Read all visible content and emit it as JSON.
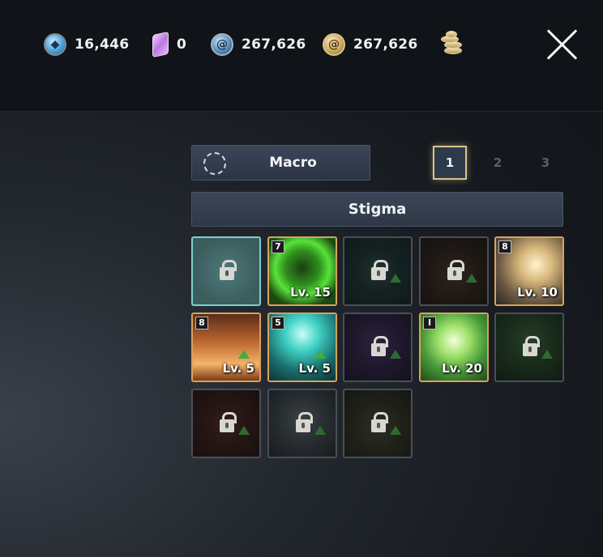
{
  "currencies": [
    {
      "name": "blue-gem",
      "value": "16,446"
    },
    {
      "name": "crystal",
      "value": "0"
    },
    {
      "name": "blue-coin",
      "value": "267,626"
    },
    {
      "name": "gold-coin",
      "value": "267,626"
    }
  ],
  "macro": {
    "label": "Macro"
  },
  "pages": [
    "1",
    "2",
    "3"
  ],
  "active_page": "1",
  "section_title": "Stigma",
  "slots": [
    {
      "state": "selected-empty",
      "tier": "",
      "level": ""
    },
    {
      "state": "unlocked",
      "tier": "7",
      "level": "Lv. 15",
      "theme": "green-heart"
    },
    {
      "state": "locked",
      "tier": "",
      "level": "",
      "theme": "teal-ring"
    },
    {
      "state": "locked",
      "tier": "",
      "level": "",
      "theme": "brown-figure"
    },
    {
      "state": "unlocked",
      "tier": "8",
      "level": "Lv. 10",
      "theme": "golden-light"
    },
    {
      "state": "unlocked",
      "tier": "8",
      "level": "Lv. 5",
      "theme": "orange-spire"
    },
    {
      "state": "unlocked",
      "tier": "5",
      "level": "Lv. 5",
      "theme": "teal-knight"
    },
    {
      "state": "locked",
      "tier": "",
      "level": "",
      "theme": "purple-orb"
    },
    {
      "state": "unlocked",
      "tier": "I",
      "level": "Lv. 20",
      "theme": "green-sparkle"
    },
    {
      "state": "locked",
      "tier": "",
      "level": "",
      "theme": "green-glow"
    },
    {
      "state": "locked",
      "tier": "",
      "level": "",
      "theme": "red-horns"
    },
    {
      "state": "locked",
      "tier": "",
      "level": "",
      "theme": "grey-wings"
    },
    {
      "state": "locked",
      "tier": "",
      "level": "",
      "theme": "olive-wings"
    }
  ]
}
